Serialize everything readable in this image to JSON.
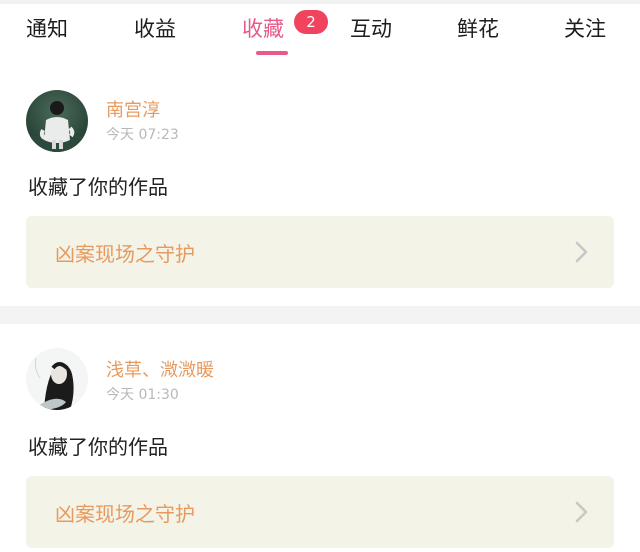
{
  "tabs": [
    {
      "label": "通知"
    },
    {
      "label": "收益"
    },
    {
      "label": "收藏",
      "badge": "2",
      "active": true
    },
    {
      "label": "互动"
    },
    {
      "label": "鲜花"
    },
    {
      "label": "关注"
    }
  ],
  "notifications": [
    {
      "user": "南宫淳",
      "time": "今天 07:23",
      "action": "收藏了你的作品",
      "work_title": "凶案现场之守护",
      "avatar": "avatar-image"
    },
    {
      "user": "浅草、溦溦暖",
      "time": "今天 01:30",
      "action": "收藏了你的作品",
      "work_title": "凶案现场之守护",
      "avatar": "avatar-image"
    }
  ],
  "colors": {
    "accent": "#e75a8c",
    "badge": "#f0435e",
    "name": "#e89a5e",
    "work_title": "#e89a5e",
    "time": "#b9b9b9",
    "box_bg": "#f3f3e8",
    "chevron": "#c8c8c8"
  }
}
